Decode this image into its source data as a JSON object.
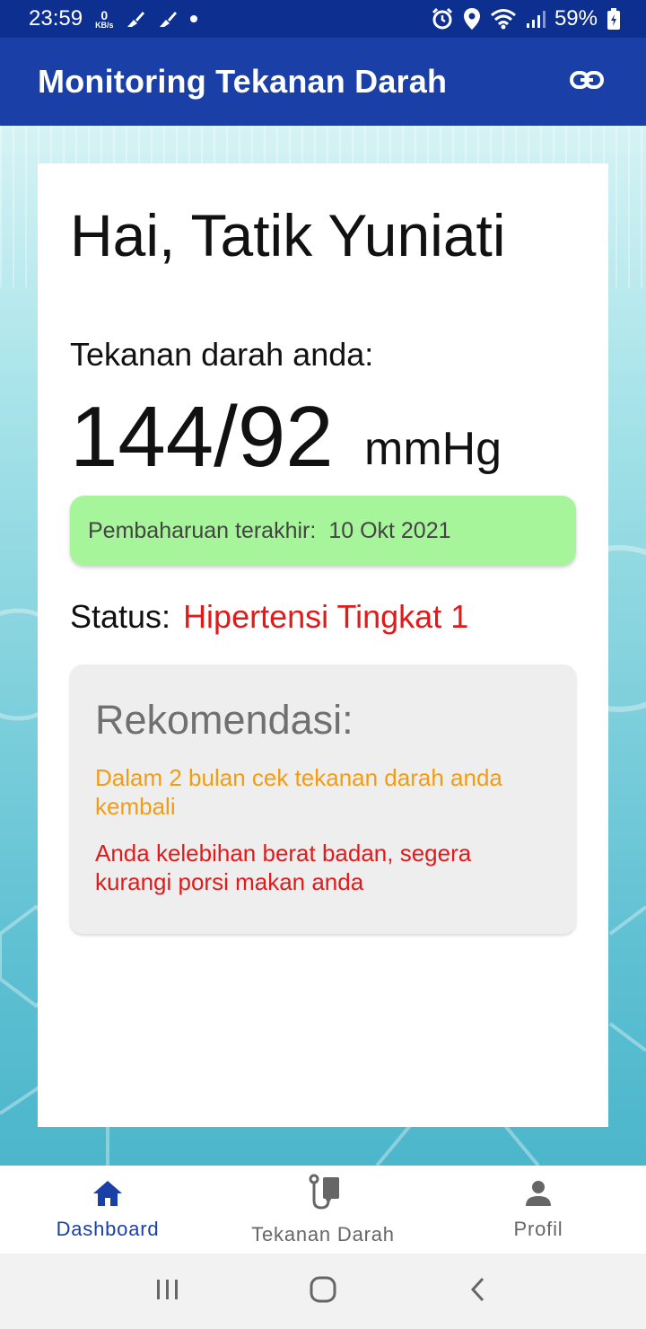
{
  "status_bar": {
    "time": "23:59",
    "net_speed_value": "0",
    "net_speed_unit": "KB/s",
    "battery": "59%"
  },
  "app_bar": {
    "title": "Monitoring Tekanan Darah"
  },
  "card": {
    "greeting": "Hai, Tatik Yuniati",
    "bp_label": "Tekanan darah anda:",
    "bp_value": "144/92",
    "bp_unit": "mmHg",
    "update_label": "Pembaharuan terakhir:",
    "update_date": "10 Okt 2021",
    "status_label": "Status:",
    "status_value": "Hipertensi Tingkat 1",
    "recommendation": {
      "title": "Rekomendasi:",
      "items": [
        {
          "text": "Dalam 2 bulan cek tekanan darah anda kembali",
          "color": "#f39c12"
        },
        {
          "text": "Anda kelebihan berat badan, segera kurangi porsi makan anda",
          "color": "#e21a1a"
        }
      ]
    }
  },
  "bottom_nav": {
    "items": [
      {
        "label": "Dashboard",
        "icon": "home-icon",
        "active": true
      },
      {
        "label": "Tekanan Darah",
        "icon": "blood-pressure-icon",
        "active": false
      },
      {
        "label": "Profil",
        "icon": "person-icon",
        "active": false
      }
    ]
  },
  "colors": {
    "primary": "#1a40a8",
    "status_bar": "#0d2f8f",
    "update_box": "#a7f59a",
    "status_red": "#e21a1a",
    "reco_orange": "#f39c12"
  }
}
